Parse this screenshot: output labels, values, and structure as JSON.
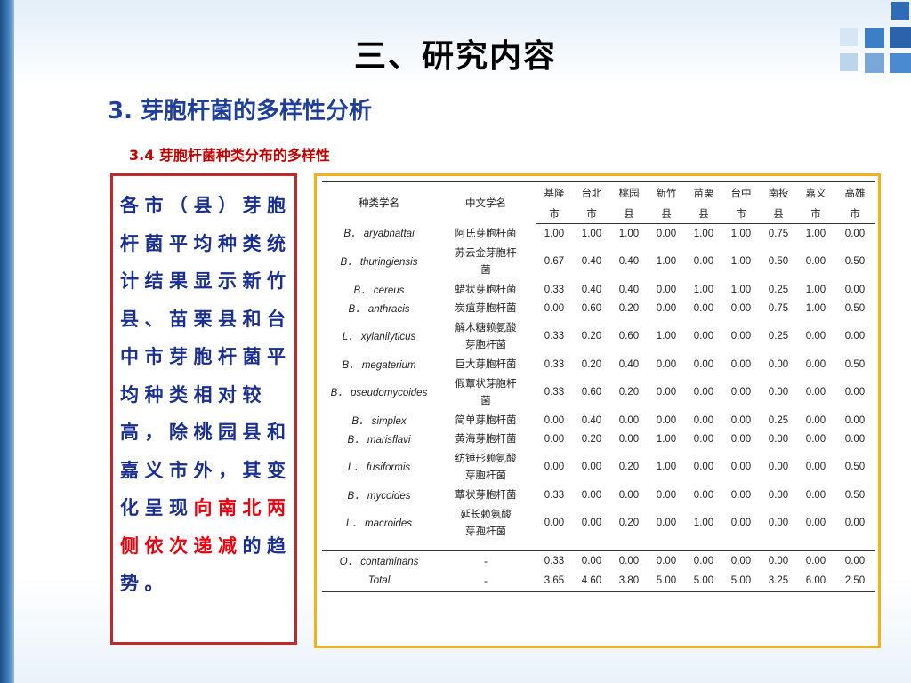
{
  "slide": {
    "title": "三、研究内容",
    "subtitle": "3. 芽胞杆菌的多样性分析",
    "subsection": "3.4 芽胞杆菌种类分布的多样性",
    "colors": {
      "border_left_box": "#c0282d",
      "border_table": "#f3b21a",
      "text_blue": "#1a2f8f",
      "highlight_red": "#e8000e"
    }
  },
  "text_box": {
    "text_main": "各市（县）芽胞杆菌平均种类统计结果显示新竹县、苗栗县和台中市芽胞杆菌平均种类相对较高，除桃园县和嘉义市外，其变化呈现",
    "text_highlight": "向南北两侧依次递减",
    "text_end": "的趋势。"
  },
  "table": {
    "col_sci": "种类学名",
    "col_cn": "中文学名",
    "regions": [
      {
        "top": "基隆",
        "bottom": "市"
      },
      {
        "top": "台北",
        "bottom": "市"
      },
      {
        "top": "桃园",
        "bottom": "县"
      },
      {
        "top": "新竹",
        "bottom": "县"
      },
      {
        "top": "苗栗",
        "bottom": "县"
      },
      {
        "top": "台中",
        "bottom": "市"
      },
      {
        "top": "南投",
        "bottom": "县"
      },
      {
        "top": "嘉义",
        "bottom": "市"
      },
      {
        "top": "高雄",
        "bottom": "市"
      }
    ],
    "rows": [
      {
        "sci": "B． aryabhattai",
        "cn": [
          "阿氏芽胞杆菌"
        ],
        "v": [
          "1.00",
          "1.00",
          "1.00",
          "0.00",
          "1.00",
          "1.00",
          "0.75",
          "1.00",
          "0.00"
        ]
      },
      {
        "sci": "B． thuringiensis",
        "cn": [
          "苏云金芽胞杆",
          "菌"
        ],
        "v": [
          "0.67",
          "0.40",
          "0.40",
          "1.00",
          "0.00",
          "1.00",
          "0.50",
          "0.00",
          "0.50"
        ]
      },
      {
        "sci": "B． cereus",
        "cn": [
          "蜡状芽胞杆菌"
        ],
        "v": [
          "0.33",
          "0.40",
          "0.40",
          "0.00",
          "1.00",
          "1.00",
          "0.25",
          "1.00",
          "0.00"
        ]
      },
      {
        "sci": "B． anthracis",
        "cn": [
          "炭疽芽胞杆菌"
        ],
        "v": [
          "0.00",
          "0.60",
          "0.20",
          "0.00",
          "0.00",
          "0.00",
          "0.75",
          "1.00",
          "0.50"
        ]
      },
      {
        "sci": "L． xylanilyticus",
        "cn": [
          "解木糖赖氨酸",
          "芽胞杆菌"
        ],
        "v": [
          "0.33",
          "0.20",
          "0.60",
          "1.00",
          "0.00",
          "0.00",
          "0.25",
          "0.00",
          "0.00"
        ]
      },
      {
        "sci": "B． megaterium",
        "cn": [
          "巨大芽胞杆菌"
        ],
        "v": [
          "0.33",
          "0.20",
          "0.40",
          "0.00",
          "0.00",
          "0.00",
          "0.00",
          "0.00",
          "0.50"
        ]
      },
      {
        "sci": "B． pseudomycoides",
        "cn": [
          "假蕈状芽胞杆",
          "菌"
        ],
        "v": [
          "0.33",
          "0.60",
          "0.20",
          "0.00",
          "0.00",
          "0.00",
          "0.00",
          "0.00",
          "0.00"
        ]
      },
      {
        "sci": "B． simplex",
        "cn": [
          "简单芽胞杆菌"
        ],
        "v": [
          "0.00",
          "0.40",
          "0.00",
          "0.00",
          "0.00",
          "0.00",
          "0.25",
          "0.00",
          "0.00"
        ]
      },
      {
        "sci": "B． marisflavi",
        "cn": [
          "黄海芽胞杆菌"
        ],
        "v": [
          "0.00",
          "0.20",
          "0.00",
          "1.00",
          "0.00",
          "0.00",
          "0.00",
          "0.00",
          "0.00"
        ]
      },
      {
        "sci": "L． fusiformis",
        "cn": [
          "纺锤形赖氨酸",
          "芽胞杆菌"
        ],
        "v": [
          "0.00",
          "0.00",
          "0.20",
          "1.00",
          "0.00",
          "0.00",
          "0.00",
          "0.00",
          "0.50"
        ]
      },
      {
        "sci": "B． mycoides",
        "cn": [
          "蕈状芽胞杆菌"
        ],
        "v": [
          "0.33",
          "0.00",
          "0.00",
          "0.00",
          "0.00",
          "0.00",
          "0.00",
          "0.00",
          "0.50"
        ]
      },
      {
        "sci": "L． macroides",
        "cn": [
          "延长赖氨酸",
          "芽孢杆菌"
        ],
        "v": [
          "0.00",
          "0.00",
          "0.20",
          "0.00",
          "1.00",
          "0.00",
          "0.00",
          "0.00",
          "0.00"
        ]
      }
    ],
    "other_rows": [
      {
        "sci": "O． contaminans",
        "cn": [
          "-"
        ],
        "v": [
          "0.33",
          "0.00",
          "0.00",
          "0.00",
          "0.00",
          "0.00",
          "0.00",
          "0.00",
          "0.00"
        ]
      },
      {
        "sci": "Total",
        "cn": [
          "-"
        ],
        "v": [
          "3.65",
          "4.60",
          "3.80",
          "5.00",
          "5.00",
          "5.00",
          "3.25",
          "6.00",
          "2.50"
        ]
      }
    ]
  }
}
